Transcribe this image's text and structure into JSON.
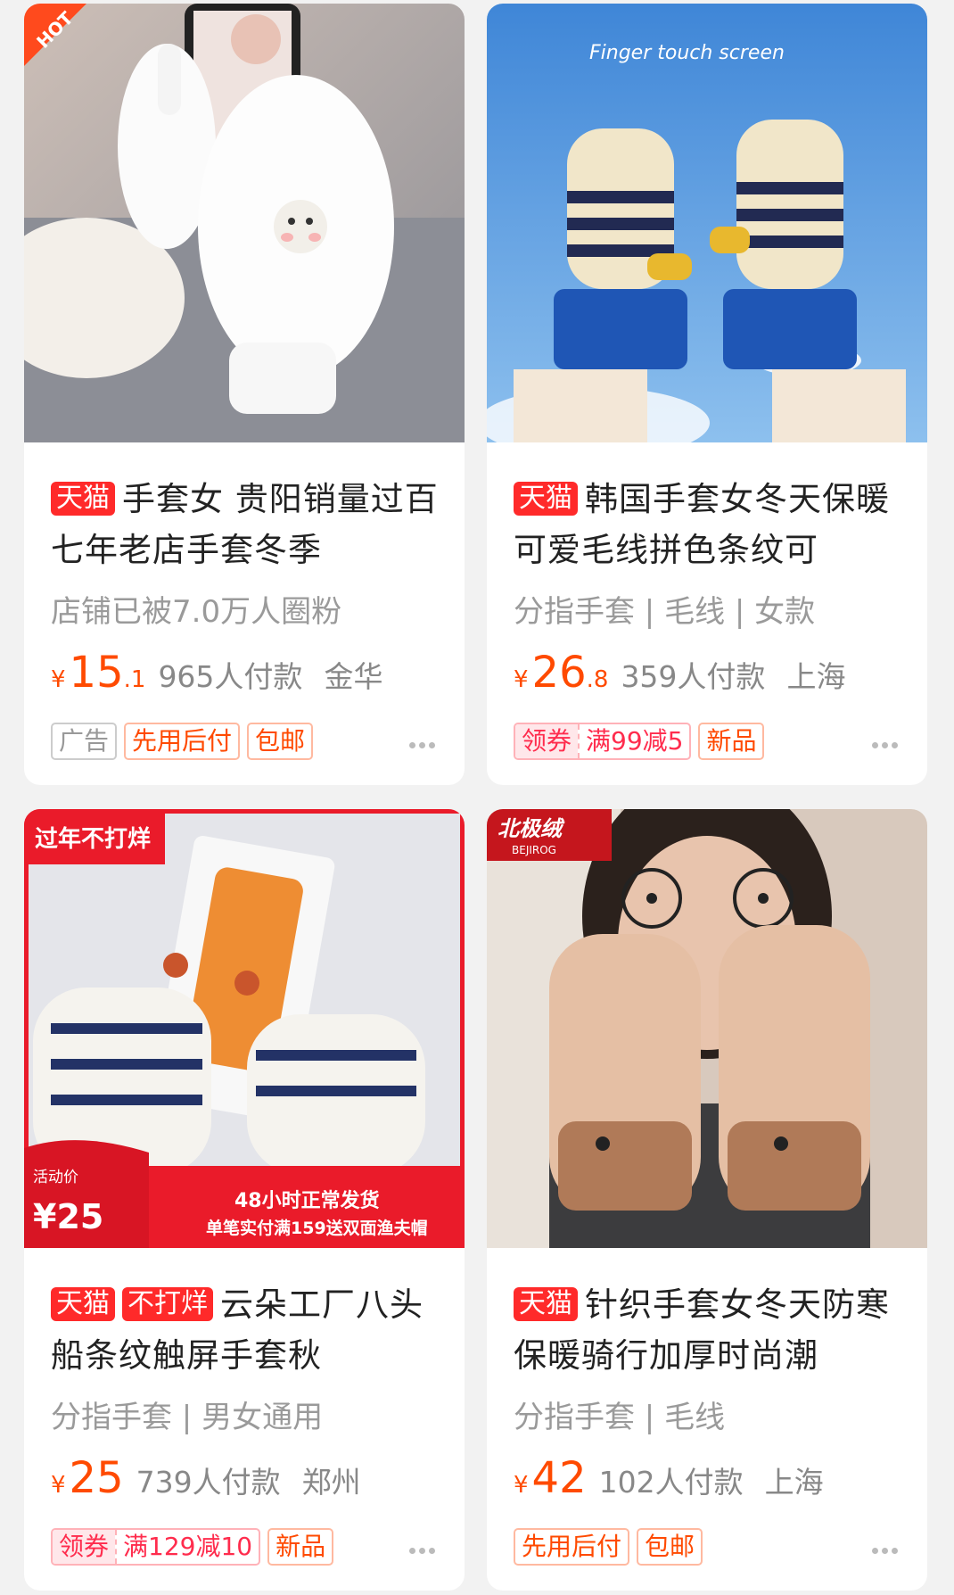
{
  "products": [
    {
      "platform_tag": "天猫",
      "extra_tag": "",
      "title": "手套女 贵阳销量过百 七年老店手套冬季",
      "attrs": "店铺已被7.0万人圈粉",
      "price_symbol": "¥",
      "price_main": "15",
      "price_decimal": ".1",
      "sales": "965人付款",
      "location": "金华",
      "corner_badge": "HOT",
      "badges": [
        "广告",
        "先用后付",
        "包邮"
      ]
    },
    {
      "platform_tag": "天猫",
      "extra_tag": "",
      "title": "韩国手套女冬天保暖可爱毛线拼色条纹可",
      "attrs": "分指手套 | 毛线 | 女款",
      "price_symbol": "¥",
      "price_main": "26",
      "price_decimal": ".8",
      "sales": "359人付款",
      "location": "上海",
      "image_caption": "Finger touch screen",
      "coupon": {
        "label": "领券",
        "value": "满99减5"
      },
      "badges": [
        "新品"
      ]
    },
    {
      "platform_tag": "天猫",
      "extra_tag": "不打烊",
      "title": "云朵工厂八头船条纹触屏手套秋",
      "attrs": "分指手套 | 男女通用",
      "price_symbol": "¥",
      "price_main": "25",
      "price_decimal": "",
      "sales": "739人付款",
      "location": "郑州",
      "promo": {
        "corner": "过年不打烊",
        "activity_label": "活动价",
        "activity_price": "¥25",
        "line1": "48小时正常发货",
        "line2": "单笔实付满159送双面渔夫帽"
      },
      "coupon": {
        "label": "领券",
        "value": "满129减10"
      },
      "badges": [
        "新品"
      ]
    },
    {
      "platform_tag": "天猫",
      "extra_tag": "",
      "title": "针织手套女冬天防寒保暖骑行加厚时尚潮",
      "attrs": "分指手套 | 毛线",
      "price_symbol": "¥",
      "price_main": "42",
      "price_decimal": "",
      "sales": "102人付款",
      "location": "上海",
      "brand_logo": "北极绒",
      "brand_logo_sub": "BEJIROG",
      "badges": [
        "先用后付",
        "包邮"
      ]
    }
  ]
}
